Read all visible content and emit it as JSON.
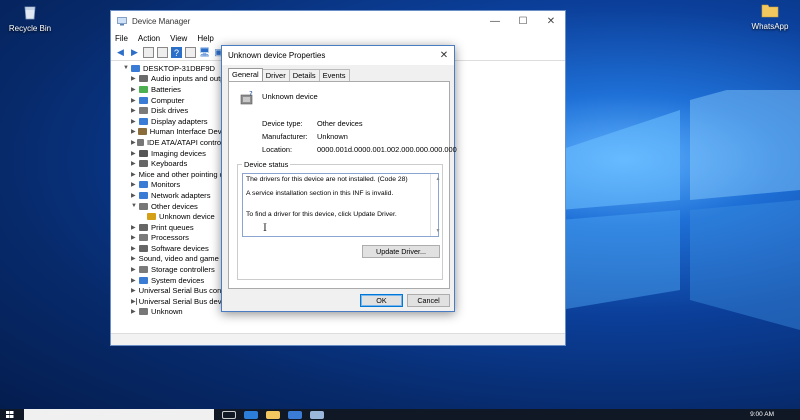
{
  "desktop": {
    "recycle_bin_label": "Recycle Bin",
    "whatsapp_label": "WhatsApp"
  },
  "device_manager": {
    "title": "Device Manager",
    "menu": [
      "File",
      "Action",
      "View",
      "Help"
    ],
    "tree": [
      {
        "label": "DESKTOP-31DBF9D",
        "level": 0,
        "expanded": true,
        "color": "#3a7bd5"
      },
      {
        "label": "Audio inputs and outputs",
        "level": 1,
        "color": "#6b6b6b"
      },
      {
        "label": "Batteries",
        "level": 1,
        "color": "#4caf50"
      },
      {
        "label": "Computer",
        "level": 1,
        "color": "#3a7bd5"
      },
      {
        "label": "Disk drives",
        "level": 1,
        "color": "#7a7a7a"
      },
      {
        "label": "Display adapters",
        "level": 1,
        "color": "#3a7bd5"
      },
      {
        "label": "Human Interface Devices",
        "level": 1,
        "color": "#8a6d3b"
      },
      {
        "label": "IDE ATA/ATAPI controllers",
        "level": 1,
        "color": "#777777"
      },
      {
        "label": "Imaging devices",
        "level": 1,
        "color": "#555555"
      },
      {
        "label": "Keyboards",
        "level": 1,
        "color": "#666666"
      },
      {
        "label": "Mice and other pointing devices",
        "level": 1,
        "color": "#666666"
      },
      {
        "label": "Monitors",
        "level": 1,
        "color": "#3a7bd5"
      },
      {
        "label": "Network adapters",
        "level": 1,
        "color": "#3a7bd5"
      },
      {
        "label": "Other devices",
        "level": 1,
        "expanded": true,
        "color": "#777777"
      },
      {
        "label": "Unknown device",
        "level": 2,
        "color": "#d4a017"
      },
      {
        "label": "Print queues",
        "level": 1,
        "color": "#666666"
      },
      {
        "label": "Processors",
        "level": 1,
        "color": "#7a7a7a"
      },
      {
        "label": "Software devices",
        "level": 1,
        "color": "#666666"
      },
      {
        "label": "Sound, video and game controllers",
        "level": 1,
        "color": "#6b6b6b"
      },
      {
        "label": "Storage controllers",
        "level": 1,
        "color": "#7a7a7a"
      },
      {
        "label": "System devices",
        "level": 1,
        "color": "#3a7bd5"
      },
      {
        "label": "Universal Serial Bus controllers",
        "level": 1,
        "color": "#666666"
      },
      {
        "label": "Universal Serial Bus devices",
        "level": 1,
        "color": "#666666"
      },
      {
        "label": "Unknown",
        "level": 1,
        "color": "#777777"
      }
    ]
  },
  "dialog": {
    "title": "Unknown device Properties",
    "tabs": [
      "General",
      "Driver",
      "Details",
      "Events"
    ],
    "device_name": "Unknown device",
    "properties": [
      {
        "label": "Device type:",
        "value": "Other devices"
      },
      {
        "label": "Manufacturer:",
        "value": "Unknown"
      },
      {
        "label": "Location:",
        "value": "0000.001d.0000.001.002.000.000.000.000"
      }
    ],
    "status_group_label": "Device status",
    "status_lines": [
      "The drivers for this device are not installed. (Code 28)",
      "A service installation section in this INF is invalid.",
      "To find a driver for this device, click Update Driver."
    ],
    "update_driver_label": "Update Driver...",
    "ok_label": "OK",
    "cancel_label": "Cancel"
  },
  "taskbar": {
    "clock": "9:00 AM"
  },
  "colors": {
    "accent": "#0078d7",
    "desktop_blue": "#0b3f9a"
  }
}
